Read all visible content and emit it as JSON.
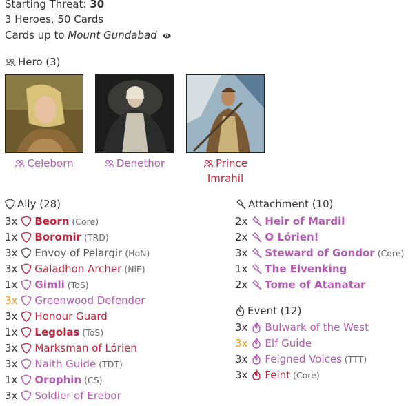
{
  "summary": {
    "threat_label": "Starting Threat:",
    "threat_value": "30",
    "counts": "3 Heroes, 50 Cards",
    "cards_up_to_label": "Cards up to",
    "cards_up_to_set": "Mount Gundabad"
  },
  "colors": {
    "tactics": "#c0243b",
    "lore": "#b35bb3",
    "neutral": "#555555",
    "highlight": "#f39c1f"
  },
  "heroes": {
    "header_label": "Hero (3)",
    "items": [
      {
        "name": "Celeborn",
        "sphere": "lore"
      },
      {
        "name": "Denethor",
        "sphere": "lore"
      },
      {
        "name": "Prince Imrahil",
        "line1": "Prince",
        "line2": "Imrahil",
        "sphere": "tactics"
      }
    ]
  },
  "allies": {
    "header_label": "Ally (28)",
    "items": [
      {
        "qty": "3x",
        "name": "Beorn",
        "set": "(Core)",
        "sphere": "tactics",
        "unique": true
      },
      {
        "qty": "1x",
        "name": "Boromir",
        "set": "(TRD)",
        "sphere": "tactics",
        "unique": true
      },
      {
        "qty": "3x",
        "name": "Envoy of Pelargir",
        "set": "(HoN)",
        "sphere": "neutral",
        "unique": false
      },
      {
        "qty": "3x",
        "name": "Galadhon Archer",
        "set": "(NiE)",
        "sphere": "tactics",
        "unique": false
      },
      {
        "qty": "1x",
        "name": "Gimli",
        "set": "(ToS)",
        "sphere": "lore",
        "unique": true
      },
      {
        "qty": "3x",
        "name": "Greenwood Defender",
        "set": "",
        "sphere": "lore",
        "unique": false,
        "highlight": true
      },
      {
        "qty": "3x",
        "name": "Honour Guard",
        "set": "",
        "sphere": "tactics",
        "unique": false
      },
      {
        "qty": "1x",
        "name": "Legolas",
        "set": "(ToS)",
        "sphere": "tactics",
        "unique": true
      },
      {
        "qty": "3x",
        "name": "Marksman of Lórien",
        "set": "",
        "sphere": "tactics",
        "unique": false
      },
      {
        "qty": "3x",
        "name": "Naith Guide",
        "set": "(TDT)",
        "sphere": "lore",
        "unique": false
      },
      {
        "qty": "1x",
        "name": "Orophin",
        "set": "(CS)",
        "sphere": "lore",
        "unique": true
      },
      {
        "qty": "3x",
        "name": "Soldier of Erebor",
        "set": "",
        "sphere": "lore",
        "unique": false
      }
    ]
  },
  "attachments": {
    "header_label": "Attachment (10)",
    "items": [
      {
        "qty": "2x",
        "name": "Heir of Mardil",
        "set": "",
        "sphere": "lore",
        "unique": true
      },
      {
        "qty": "2x",
        "name": "O Lórien!",
        "set": "",
        "sphere": "lore",
        "unique": true
      },
      {
        "qty": "3x",
        "name": "Steward of Gondor",
        "set": "(Core)",
        "sphere": "lore",
        "unique": true
      },
      {
        "qty": "1x",
        "name": "The Elvenking",
        "set": "",
        "sphere": "lore",
        "unique": true
      },
      {
        "qty": "2x",
        "name": "Tome of Atanatar",
        "set": "",
        "sphere": "lore",
        "unique": true
      }
    ]
  },
  "events": {
    "header_label": "Event (12)",
    "items": [
      {
        "qty": "3x",
        "name": "Bulwark of the West",
        "set": "",
        "sphere": "lore",
        "unique": false
      },
      {
        "qty": "3x",
        "name": "Elf Guide",
        "set": "",
        "sphere": "lore",
        "unique": false,
        "highlight": true
      },
      {
        "qty": "3x",
        "name": "Feigned Voices",
        "set": "(TTT)",
        "sphere": "lore",
        "unique": false
      },
      {
        "qty": "3x",
        "name": "Feint",
        "set": "(Core)",
        "sphere": "tactics",
        "unique": false
      }
    ]
  }
}
